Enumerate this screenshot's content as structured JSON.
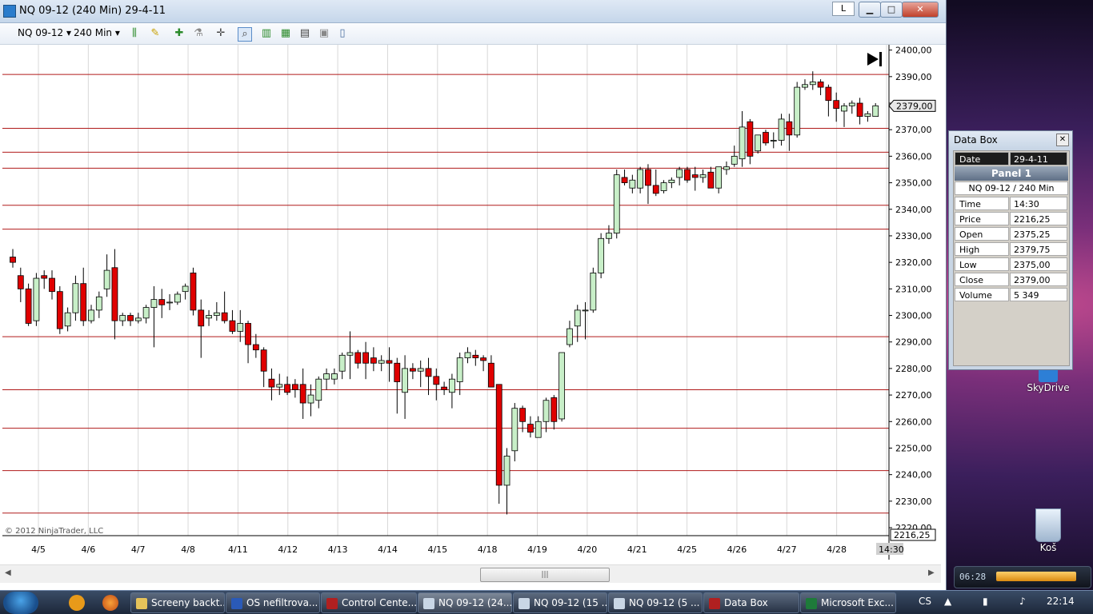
{
  "window": {
    "title": "NQ 09-12 (240 Min)  29-4-11",
    "btn_l": "L",
    "btn_min": "▁",
    "btn_max": "□",
    "btn_close": "✕"
  },
  "toolbar": {
    "instrument": "NQ 09-12",
    "interval": "240 Min",
    "icons": [
      "bars-type-icon",
      "pencil-icon",
      "add-indicator-icon",
      "strategy-icon",
      "crosshair-icon",
      "zoom-icon",
      "data-series-icon",
      "indicators-icon",
      "chart-style-icon",
      "properties-icon",
      "datebox-icon"
    ]
  },
  "chart": {
    "copyright": "© 2012 NinjaTrader, LLC",
    "price_axis": [
      "2400,00",
      "2390,00",
      "2380,00",
      "2370,00",
      "2360,00",
      "2350,00",
      "2340,00",
      "2330,00",
      "2320,00",
      "2310,00",
      "2300,00",
      "2290,00",
      "2280,00",
      "2270,00",
      "2260,00",
      "2250,00",
      "2240,00",
      "2230,00",
      "2220,00"
    ],
    "last_price": "2379,00",
    "low_price_label": "2216,25",
    "dates": [
      "4/5",
      "4/6",
      "4/7",
      "4/8",
      "4/11",
      "4/12",
      "4/13",
      "4/14",
      "4/15",
      "4/18",
      "4/19",
      "4/20",
      "4/21",
      "4/25",
      "4/26",
      "4/27",
      "4/28",
      "4/29"
    ],
    "time_label": "14:30",
    "up_color": "#c8efc8",
    "down_color": "#e00000",
    "hline_color": "#b01a1a",
    "hlines": [
      2390.8,
      2370.5,
      2361.5,
      2355.5,
      2341.5,
      2332.5,
      2292,
      2272,
      2257.5,
      2241.5,
      2225.5
    ]
  },
  "chart_data": {
    "type": "candlestick",
    "ylim": [
      2217,
      2402
    ],
    "candles": [
      [
        2322,
        2325,
        2318,
        2320
      ],
      [
        2315,
        2318,
        2305,
        2310
      ],
      [
        2310,
        2312,
        2296,
        2297
      ],
      [
        2298,
        2316,
        2296,
        2314
      ],
      [
        2315,
        2317,
        2310,
        2314
      ],
      [
        2314,
        2317,
        2306,
        2309
      ],
      [
        2309,
        2311,
        2293,
        2295
      ],
      [
        2296,
        2303,
        2294,
        2301
      ],
      [
        2301,
        2315,
        2298,
        2312
      ],
      [
        2312,
        2318,
        2296,
        2298
      ],
      [
        2298,
        2304,
        2297,
        2302
      ],
      [
        2302,
        2309,
        2299,
        2307
      ],
      [
        2310,
        2323,
        2307,
        2317
      ],
      [
        2318,
        2325,
        2291,
        2298
      ],
      [
        2298,
        2301,
        2296,
        2300
      ],
      [
        2300,
        2301,
        2296,
        2298
      ],
      [
        2298,
        2301,
        2297,
        2299
      ],
      [
        2299,
        2304,
        2297,
        2303
      ],
      [
        2303,
        2311,
        2288,
        2306
      ],
      [
        2306,
        2310,
        2299,
        2304
      ],
      [
        2305,
        2308,
        2302,
        2305
      ],
      [
        2305,
        2309,
        2304,
        2308
      ],
      [
        2309,
        2312,
        2306,
        2311
      ],
      [
        2316,
        2318,
        2300,
        2302
      ],
      [
        2302,
        2306,
        2284,
        2296
      ],
      [
        2299,
        2302,
        2296,
        2300
      ],
      [
        2300,
        2305,
        2298,
        2301
      ],
      [
        2301,
        2309,
        2297,
        2298
      ],
      [
        2298,
        2302,
        2293,
        2294
      ],
      [
        2294,
        2302,
        2290,
        2297
      ],
      [
        2297,
        2298,
        2282,
        2289
      ],
      [
        2289,
        2293,
        2284,
        2287
      ],
      [
        2287,
        2288,
        2273,
        2279
      ],
      [
        2276,
        2280,
        2268,
        2273
      ],
      [
        2273,
        2278,
        2270,
        2274
      ],
      [
        2274,
        2277,
        2270,
        2271
      ],
      [
        2274,
        2276,
        2269,
        2272
      ],
      [
        2274,
        2280,
        2261,
        2267
      ],
      [
        2267,
        2274,
        2262,
        2270
      ],
      [
        2268,
        2277,
        2265,
        2276
      ],
      [
        2276,
        2280,
        2272,
        2278
      ],
      [
        2276,
        2280,
        2274,
        2278
      ],
      [
        2279,
        2286,
        2276,
        2285
      ],
      [
        2285,
        2294,
        2276,
        2286
      ],
      [
        2286,
        2287,
        2280,
        2282
      ],
      [
        2286,
        2290,
        2276,
        2282
      ],
      [
        2284,
        2288,
        2279,
        2282
      ],
      [
        2282,
        2285,
        2279,
        2283
      ],
      [
        2283,
        2288,
        2275,
        2282
      ],
      [
        2282,
        2284,
        2263,
        2275
      ],
      [
        2271,
        2285,
        2261,
        2280
      ],
      [
        2280,
        2282,
        2276,
        2279
      ],
      [
        2279,
        2283,
        2273,
        2280
      ],
      [
        2280,
        2284,
        2270,
        2277
      ],
      [
        2277,
        2280,
        2268,
        2274
      ],
      [
        2273,
        2275,
        2270,
        2272
      ],
      [
        2271,
        2278,
        2265,
        2276
      ],
      [
        2275,
        2286,
        2270,
        2284
      ],
      [
        2284,
        2288,
        2282,
        2286
      ],
      [
        2285,
        2287,
        2281,
        2284
      ],
      [
        2284,
        2285,
        2279,
        2283
      ],
      [
        2282,
        2285,
        2276,
        2273
      ],
      [
        2274,
        2274,
        2229,
        2236
      ],
      [
        2236,
        2250,
        2225,
        2247
      ],
      [
        2249,
        2267,
        2245,
        2265
      ],
      [
        2265,
        2266,
        2256,
        2260
      ],
      [
        2259,
        2262,
        2254,
        2256
      ],
      [
        2254,
        2262,
        2254,
        2260
      ],
      [
        2260,
        2269,
        2256,
        2268
      ],
      [
        2269,
        2270,
        2257,
        2260
      ],
      [
        2261,
        2285,
        2260,
        2286
      ],
      [
        2289,
        2298,
        2288,
        2295
      ],
      [
        2296,
        2304,
        2290,
        2302
      ],
      [
        2302,
        2305,
        2291,
        2302
      ],
      [
        2302,
        2318,
        2301,
        2316
      ],
      [
        2316,
        2331,
        2314,
        2329
      ],
      [
        2329,
        2334,
        2327,
        2331
      ],
      [
        2331,
        2355,
        2329,
        2353
      ],
      [
        2352,
        2355,
        2349,
        2350
      ],
      [
        2348,
        2353,
        2346,
        2351
      ],
      [
        2348,
        2356,
        2346,
        2355
      ],
      [
        2355,
        2357,
        2342,
        2349
      ],
      [
        2349,
        2355,
        2345,
        2346
      ],
      [
        2347,
        2351,
        2346,
        2350
      ],
      [
        2350,
        2352,
        2348,
        2351
      ],
      [
        2352,
        2356,
        2349,
        2355
      ],
      [
        2355,
        2356,
        2350,
        2351
      ],
      [
        2353,
        2356,
        2347,
        2352
      ],
      [
        2352,
        2355,
        2350,
        2353
      ],
      [
        2354,
        2356,
        2350,
        2348
      ],
      [
        2348,
        2356,
        2346,
        2356
      ],
      [
        2355,
        2358,
        2353,
        2356
      ],
      [
        2357,
        2364,
        2356,
        2360
      ],
      [
        2359,
        2377,
        2356,
        2371
      ],
      [
        2373,
        2374,
        2357,
        2360
      ],
      [
        2362,
        2368,
        2361,
        2368
      ],
      [
        2369,
        2370,
        2364,
        2365
      ],
      [
        2366,
        2369,
        2363,
        2366
      ],
      [
        2366,
        2376,
        2364,
        2374
      ],
      [
        2373,
        2376,
        2362,
        2368
      ],
      [
        2368,
        2388,
        2367,
        2386
      ],
      [
        2386,
        2389,
        2385,
        2387
      ],
      [
        2387,
        2392,
        2385,
        2388
      ],
      [
        2388,
        2389,
        2383,
        2386
      ],
      [
        2386,
        2387,
        2375,
        2381
      ],
      [
        2381,
        2384,
        2373,
        2378
      ],
      [
        2377,
        2380,
        2371,
        2379
      ],
      [
        2379,
        2381,
        2376,
        2380
      ],
      [
        2380,
        2382,
        2372,
        2375
      ],
      [
        2375,
        2377,
        2373,
        2376
      ],
      [
        2375,
        2380,
        2375,
        2379
      ]
    ]
  },
  "databox": {
    "title": "Data Box",
    "date_label": "Date",
    "date_value": "29-4-11",
    "panel": "Panel 1",
    "series": "NQ 09-12 / 240 Min",
    "rows": [
      {
        "k": "Time",
        "v": "14:30"
      },
      {
        "k": "Price",
        "v": "2216,25"
      },
      {
        "k": "Open",
        "v": "2375,25"
      },
      {
        "k": "High",
        "v": "2379,75"
      },
      {
        "k": "Low",
        "v": "2375,00"
      },
      {
        "k": "Close",
        "v": "2379,00"
      },
      {
        "k": "Volume",
        "v": "5 349"
      }
    ]
  },
  "desktop": {
    "skydrive": "SkyDrive",
    "recycle": "Koš",
    "gadget_time": "06:28"
  },
  "taskbar": {
    "apps": [
      "Screeny backt...",
      "OS nefiltrova...",
      "Control Cente...",
      "NQ 09-12 (24...",
      "NQ 09-12 (15 ...",
      "NQ 09-12 (5 ...",
      "Data Box",
      "Microsoft Exc..."
    ],
    "lang": "CS",
    "clock": "22:14"
  }
}
